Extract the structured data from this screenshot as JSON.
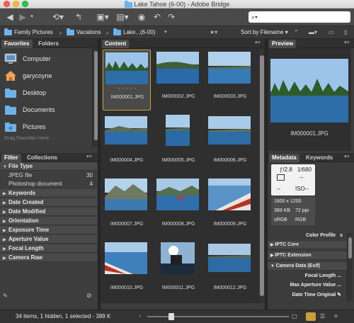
{
  "window": {
    "title": "Lake Tahoe (6-00) - Adobe Bridge"
  },
  "toolbar": {
    "search_placeholder": "",
    "search_icon_glyph": "⌕▾"
  },
  "path": {
    "crumbs": [
      "Family Pictures",
      "Vacations",
      "Lake...(6-00)"
    ],
    "sort_label": "Sort by Filename"
  },
  "favorites": {
    "tabs": [
      "Favorites",
      "Folders"
    ],
    "items": [
      "Computer",
      "garycoyne",
      "Desktop",
      "Documents",
      "Pictures"
    ],
    "hint": "Drag Favorites Here..."
  },
  "filter": {
    "tabs": [
      "Filter",
      "Collections"
    ],
    "file_type": {
      "label": "File Type",
      "entries": [
        {
          "name": "JPEG file",
          "count": "30"
        },
        {
          "name": "Photoshop document",
          "count": "4"
        }
      ]
    },
    "groups": [
      "Keywords",
      "Date Created",
      "Date Modified",
      "Orientation",
      "Exposure Time",
      "Aperture Value",
      "Focal Length",
      "Camera Raw"
    ]
  },
  "content": {
    "tab": "Content",
    "thumbs": [
      "IM000001.JPG",
      "IM000002.JPG",
      "IM000003.JPG",
      "IM000004.JPG",
      "IM000005.JPG",
      "IM000006.JPG",
      "IM000007.JPG",
      "IM000008.JPG",
      "IM000009.JPG",
      "IM000010.JPG",
      "IM000011.JPG",
      "IM000012.JPG"
    ],
    "dots": "• • • • •"
  },
  "preview": {
    "tab": "Preview",
    "filename": "IM000001.JPG"
  },
  "metadata": {
    "tabs": [
      "Metadata",
      "Keywords"
    ],
    "aperture": "ƒ/2.8",
    "shutter": "1/680",
    "dash1": "--",
    "dash2": "--",
    "iso": "ISO--",
    "dims": "1600 x 1200",
    "size": "389 KB",
    "ppi": "72 ppi",
    "color1": "sRGB",
    "color2": "RGB",
    "color_profile": "Color Profile",
    "color_profile_value": "s",
    "sections": [
      "IPTC Core",
      "IPTC Extension",
      "Camera Data (Exif)"
    ],
    "exif_rows": [
      {
        "label": "Focal Length",
        "value": "..."
      },
      {
        "label": "Max Aperture Value",
        "value": "..."
      },
      {
        "label": "Date Time Original",
        "value": "✎"
      }
    ]
  },
  "status": {
    "text": "34 items, 1 hidden, 1 selected - 389 K"
  },
  "colors": {
    "accent": "#c8a03a",
    "folder": "#6db2e8"
  }
}
